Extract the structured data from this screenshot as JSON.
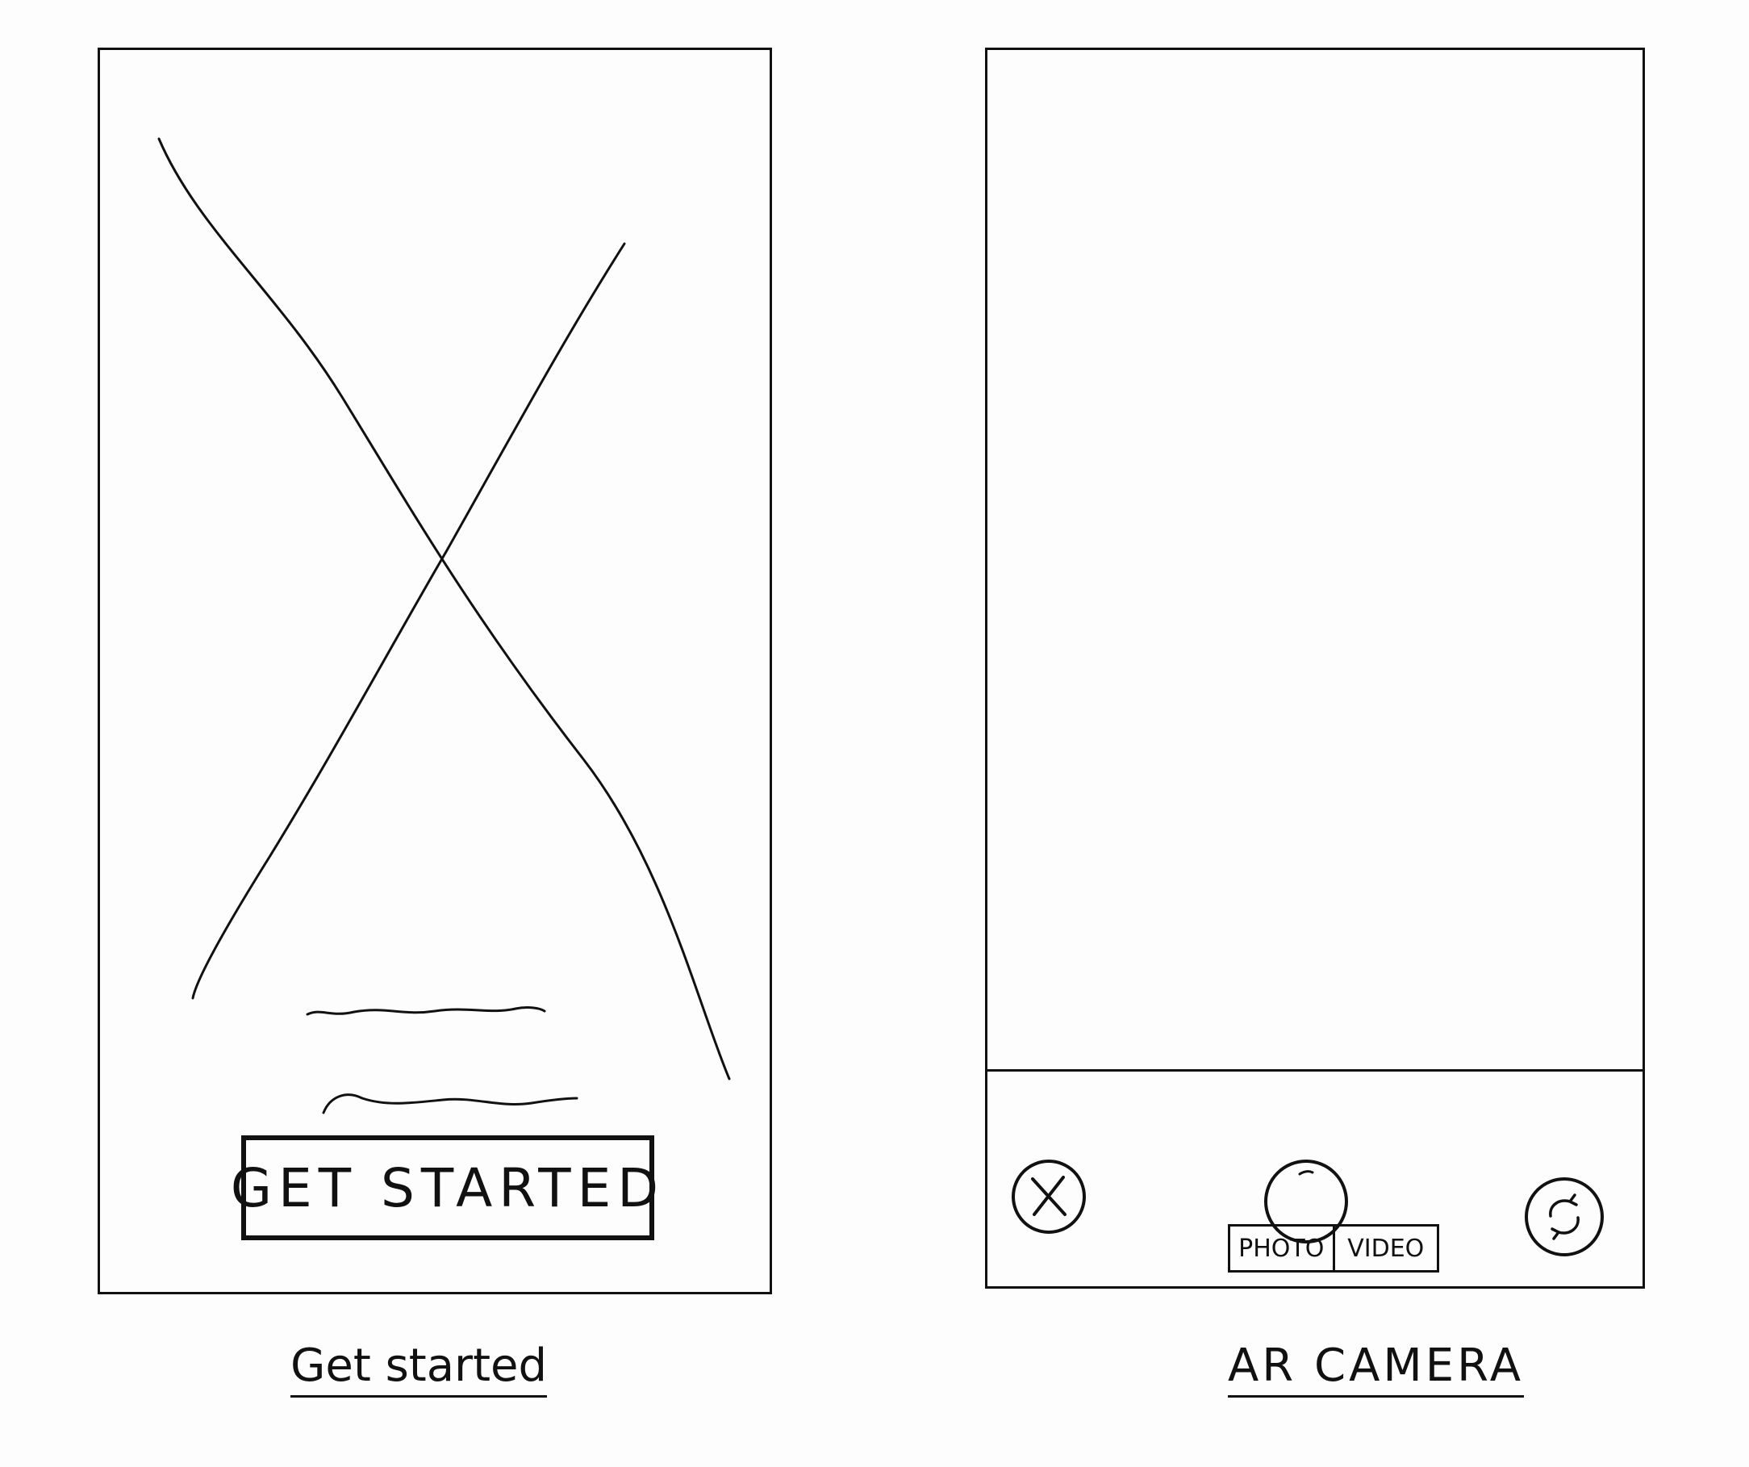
{
  "screens": [
    {
      "caption": "Get started",
      "button_label": "GET STARTED",
      "image_placeholder_icon": "image-placeholder-x",
      "text_placeholder_lines": 2
    },
    {
      "caption": "AR CAMERA",
      "controls": {
        "close_icon": "close-circle-icon",
        "shutter_icon": "shutter-circle-icon",
        "flip_icon": "camera-flip-icon"
      },
      "mode_options": [
        "PHOTO",
        "VIDEO"
      ]
    }
  ],
  "colors": {
    "ink": "#111111",
    "paper": "#fdfdfd"
  }
}
